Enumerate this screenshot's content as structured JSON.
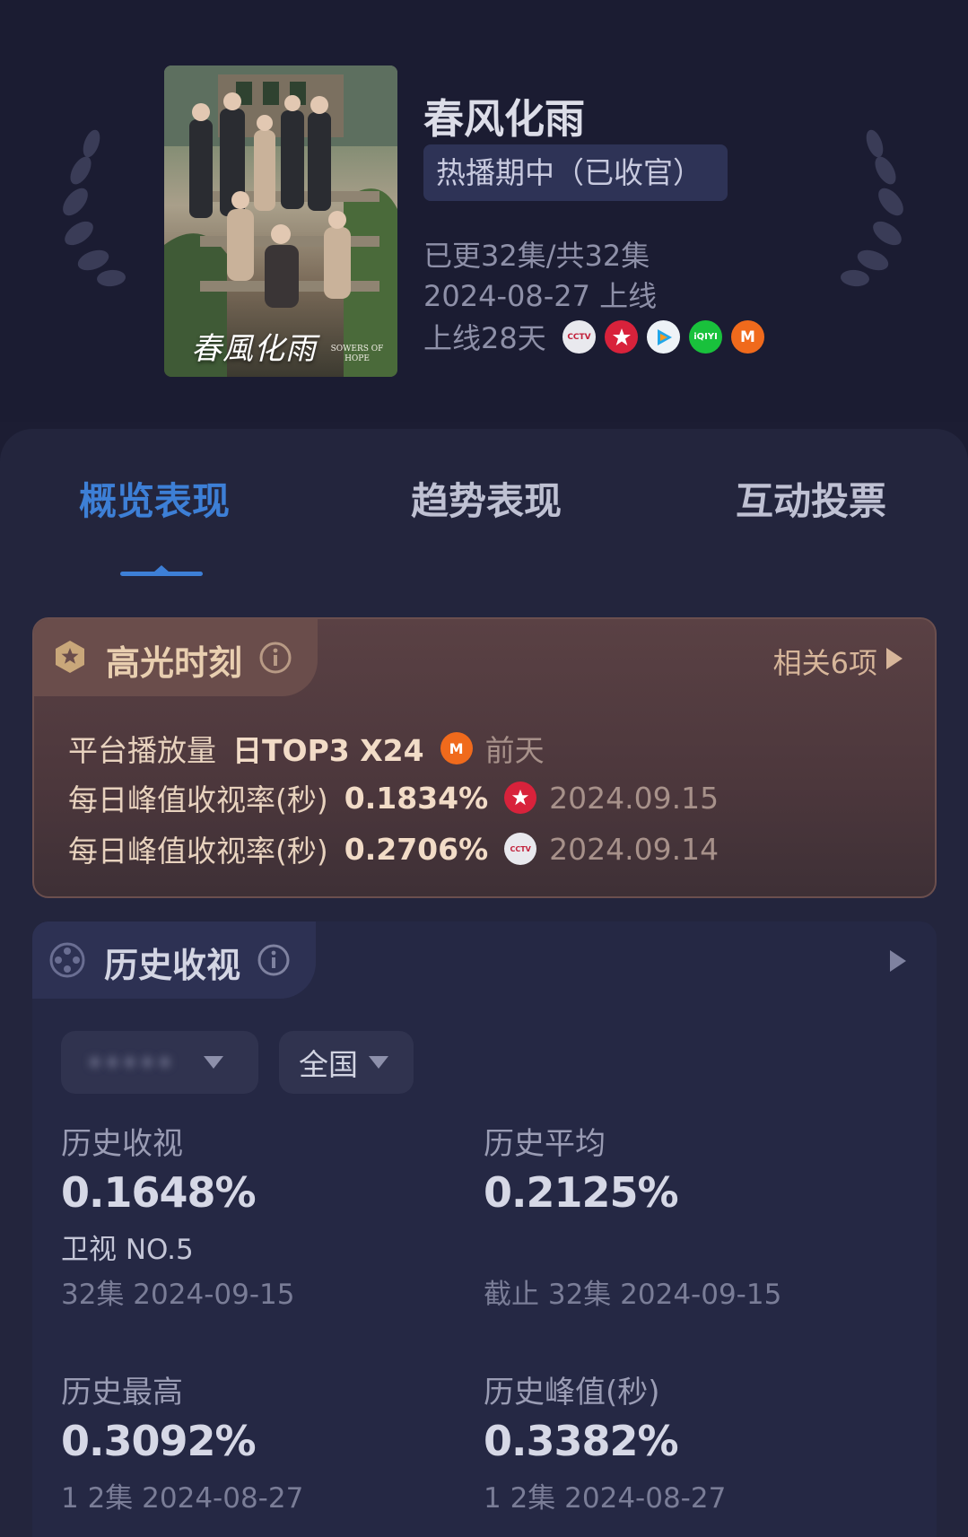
{
  "show": {
    "title": "春风化雨",
    "status": "热播期中（已收官）",
    "episodes": "已更32集/共32集",
    "release": "2024-08-27 上线",
    "online_days": "上线28天",
    "poster_title": "春風化雨",
    "poster_subtitle": "SOWERS OF HOPE",
    "platforms": [
      {
        "name": "cctv-icon",
        "color": "#e9e9ee"
      },
      {
        "name": "dragon-tv-icon",
        "color": "#d8223b"
      },
      {
        "name": "tencent-video-icon",
        "color": "#22a7e8"
      },
      {
        "name": "iqiyi-icon",
        "color": "#19c13c"
      },
      {
        "name": "mango-tv-icon",
        "color": "#f06a1c"
      }
    ]
  },
  "tabs": [
    {
      "label": "概览表现",
      "active": true
    },
    {
      "label": "趋势表现",
      "active": false
    },
    {
      "label": "互动投票",
      "active": false
    }
  ],
  "highlight": {
    "title": "高光时刻",
    "more": "相关6项",
    "rows": [
      {
        "label": "平台播放量",
        "value": "日TOP3 X24",
        "when": "前天"
      },
      {
        "label": "每日峰值收视率(秒)",
        "value": "0.1834%",
        "when": "2024.09.15"
      },
      {
        "label": "每日峰值收视率(秒)",
        "value": "0.2706%",
        "when": "2024.09.14"
      }
    ]
  },
  "history": {
    "title": "历史收视",
    "filter_source": "•••••",
    "filter_region": "全国",
    "stats": [
      {
        "label": "历史收视",
        "value": "0.1648%",
        "sub": "卫视 NO.5",
        "foot": "32集 2024-09-15"
      },
      {
        "label": "历史平均",
        "value": "0.2125%",
        "sub": "",
        "foot": "截止 32集 2024-09-15"
      },
      {
        "label": "历史最高",
        "value": "0.3092%",
        "sub": "",
        "foot": "1 2集 2024-08-27"
      },
      {
        "label": "历史峰值(秒)",
        "value": "0.3382%",
        "sub": "",
        "foot": "1 2集 2024-08-27"
      }
    ]
  },
  "colors": {
    "accent": "#3d7fd6",
    "background": "#1c1d33",
    "highlight_text": "#e8d2be"
  }
}
